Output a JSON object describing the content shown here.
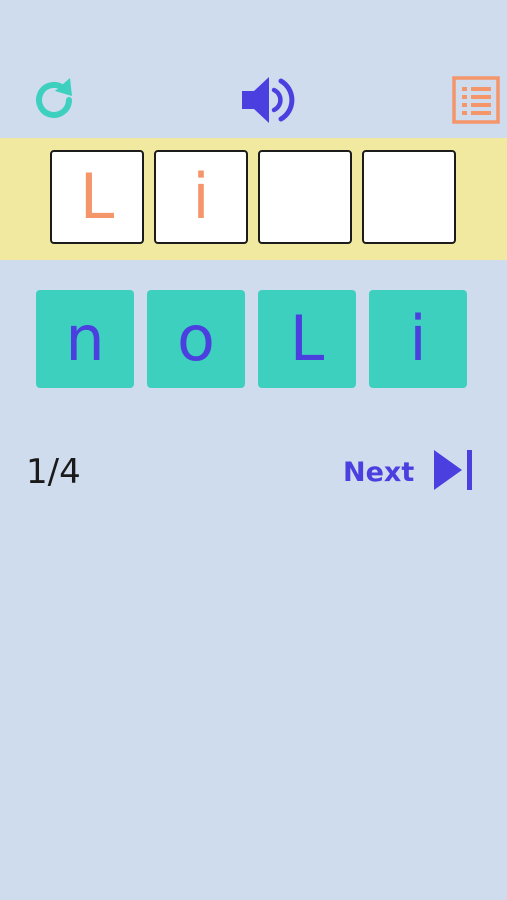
{
  "toolbar": {
    "reload_icon": "reload-icon",
    "sound_icon": "speaker-icon",
    "list_icon": "list-icon"
  },
  "answer": {
    "slots": [
      "L",
      "i",
      "",
      ""
    ]
  },
  "tiles": [
    "n",
    "o",
    "L",
    "i"
  ],
  "footer": {
    "progress": "1/4",
    "next_label": "Next"
  },
  "colors": {
    "background": "#cfdcee",
    "answer_band": "#f2e9a0",
    "tile": "#3dd0bf",
    "tile_letter": "#4b3fe0",
    "answer_letter": "#f4956a",
    "accent_teal": "#3dd0bf",
    "accent_orange": "#f4956a",
    "accent_blue": "#4b3fe0"
  }
}
